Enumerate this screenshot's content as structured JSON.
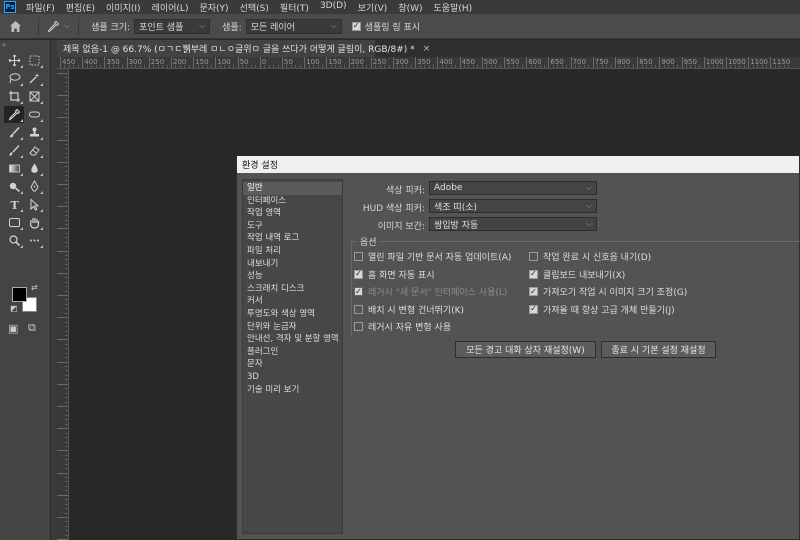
{
  "app": {
    "logo": "Ps"
  },
  "menu": [
    "파일(F)",
    "편집(E)",
    "이미지(I)",
    "레이어(L)",
    "문자(Y)",
    "선택(S)",
    "필터(T)",
    "3D(D)",
    "보기(V)",
    "창(W)",
    "도움말(H)"
  ],
  "options": {
    "sample_size_label": "샘플 크기:",
    "sample_size_value": "포인트 샘플",
    "sample_label": "샘플:",
    "sample_value": "모든 레이어",
    "show_ring_label": "샘플링 링 표시",
    "home_icon": "home-icon",
    "eyedropper_icon": "eyedropper-icon"
  },
  "document": {
    "tab_title": "제목 없음-1 @ 66.7% (ㅁㄱㄷ뷁부레 ㅁㄴㅇ글위ㅁ 글을 쓰다가 어떻게 글림이, RGB/8#) *",
    "close": "×"
  },
  "ruler": {
    "h_ticks": [
      "450",
      "400",
      "350",
      "300",
      "250",
      "200",
      "150",
      "100",
      "50",
      "0",
      "50",
      "100",
      "150",
      "200",
      "250",
      "300",
      "350",
      "400",
      "450",
      "500",
      "550",
      "600",
      "650",
      "700",
      "750",
      "800",
      "850",
      "900",
      "950",
      "1000",
      "1050",
      "1100",
      "1150"
    ]
  },
  "dialog": {
    "title": "환경 설정",
    "sidebar": [
      "일반",
      "인터페이스",
      "작업 영역",
      "도구",
      "작업 내역 로그",
      "파일 처리",
      "내보내기",
      "성능",
      "스크래치 디스크",
      "커서",
      "투명도와 색상 영역",
      "단위와 눈금자",
      "안내선, 격자 및 분할 영역",
      "플러그인",
      "문자",
      "3D",
      "기술 미리 보기"
    ],
    "selected_index": 0,
    "color_picker_label": "색상 피커:",
    "color_picker_value": "Adobe",
    "hud_picker_label": "HUD 색상 피커:",
    "hud_picker_value": "색조 띠(소)",
    "interp_label": "이미지 보간:",
    "interp_value": "쌍입방 자동",
    "options_legend": "옵션",
    "options_left": [
      {
        "label": "열린 파일 기반 문서 자동 업데이트(A)",
        "checked": false,
        "disabled": false
      },
      {
        "label": "홈 화면 자동 표시",
        "checked": true,
        "disabled": false
      },
      {
        "label": "레거시 \"새 문서\" 인터페이스 사용(L)",
        "checked": true,
        "disabled": true
      },
      {
        "label": "배치 시 변형 건너뛰기(K)",
        "checked": false,
        "disabled": false
      },
      {
        "label": "레거시 자유 변형 사용",
        "checked": false,
        "disabled": false
      }
    ],
    "options_right": [
      {
        "label": "작업 완료 시 신호음 내기(D)",
        "checked": false,
        "disabled": false
      },
      {
        "label": "클립보드 내보내기(X)",
        "checked": true,
        "disabled": false
      },
      {
        "label": "가져오기 작업 시 이미지 크기 조정(G)",
        "checked": true,
        "disabled": false
      },
      {
        "label": "가져올 때 항상 고급 개체 만들기(J)",
        "checked": true,
        "disabled": false
      }
    ],
    "reset_warnings_btn": "모든 경고 대화 상자 재설정(W)",
    "reset_prefs_btn": "종료 시 기본 설정 재설정"
  }
}
